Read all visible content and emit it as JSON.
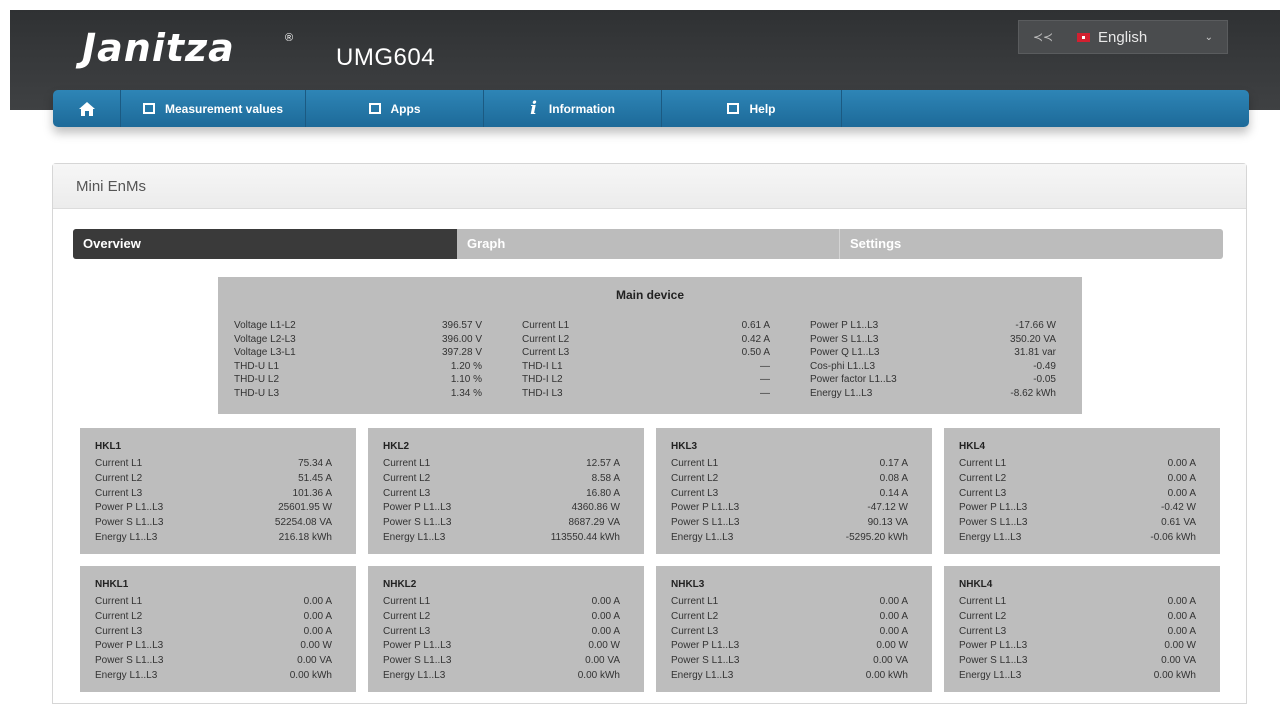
{
  "header": {
    "brand": "Janitza",
    "registered": "®",
    "model": "UMG604",
    "language": {
      "flag_icon": "flag-icon",
      "label": "English",
      "chevron": "⌄"
    }
  },
  "nav": {
    "home_icon": "home-icon",
    "items": [
      {
        "label": "Measurement values",
        "icon": "measurement-icon"
      },
      {
        "label": "Apps",
        "icon": "apps-icon"
      },
      {
        "label": "Information",
        "icon": "info-icon"
      },
      {
        "label": "Help",
        "icon": "help-icon"
      }
    ]
  },
  "panel": {
    "title": "Mini EnMs",
    "tabs": [
      "Overview",
      "Graph",
      "Settings"
    ]
  },
  "main_device": {
    "title": "Main device",
    "col1_labels": [
      "Voltage L1-L2",
      "Voltage L2-L3",
      "Voltage L3-L1",
      "THD-U L1",
      "THD-U L2",
      "THD-U L3"
    ],
    "col1_values": [
      "396.57 V",
      "396.00 V",
      "397.28 V",
      "1.20 %",
      "1.10 %",
      "1.34 %"
    ],
    "col2_labels": [
      "Current L1",
      "Current L2",
      "Current L3",
      "THD-I L1",
      "THD-I L2",
      "THD-I L3"
    ],
    "col2_values": [
      "0.61 A",
      "0.42 A",
      "0.50 A",
      "—",
      "—",
      "—"
    ],
    "col3_labels": [
      "Power P L1..L3",
      "Power S L1..L3",
      "Power Q L1..L3",
      "Cos-phi L1..L3",
      "Power factor L1..L3",
      "Energy L1..L3"
    ],
    "col3_values": [
      "-17.66 W",
      "350.20 VA",
      "31.81 var",
      "-0.49",
      "-0.05",
      "-8.62 kWh"
    ]
  },
  "boxes": [
    {
      "title": "HKL1",
      "labels": [
        "Current L1",
        "Current L2",
        "Current L3",
        "Power P L1..L3",
        "Power S L1..L3",
        "Energy L1..L3"
      ],
      "values": [
        "75.34 A",
        "51.45 A",
        "101.36 A",
        "25601.95 W",
        "52254.08 VA",
        "216.18 kWh"
      ]
    },
    {
      "title": "HKL2",
      "labels": [
        "Current L1",
        "Current L2",
        "Current L3",
        "Power P L1..L3",
        "Power S L1..L3",
        "Energy L1..L3"
      ],
      "values": [
        "12.57 A",
        "8.58 A",
        "16.80 A",
        "4360.86 W",
        "8687.29 VA",
        "113550.44 kWh"
      ]
    },
    {
      "title": "HKL3",
      "labels": [
        "Current L1",
        "Current L2",
        "Current L3",
        "Power P L1..L3",
        "Power S L1..L3",
        "Energy L1..L3"
      ],
      "values": [
        "0.17 A",
        "0.08 A",
        "0.14 A",
        "-47.12 W",
        "90.13 VA",
        "-5295.20 kWh"
      ]
    },
    {
      "title": "HKL4",
      "labels": [
        "Current L1",
        "Current L2",
        "Current L3",
        "Power P L1..L3",
        "Power S L1..L3",
        "Energy L1..L3"
      ],
      "values": [
        "0.00 A",
        "0.00 A",
        "0.00 A",
        "-0.42 W",
        "0.61 VA",
        "-0.06 kWh"
      ]
    },
    {
      "title": "NHKL1",
      "labels": [
        "Current L1",
        "Current L2",
        "Current L3",
        "Power P L1..L3",
        "Power S L1..L3",
        "Energy L1..L3"
      ],
      "values": [
        "0.00 A",
        "0.00 A",
        "0.00 A",
        "0.00 W",
        "0.00 VA",
        "0.00 kWh"
      ]
    },
    {
      "title": "NHKL2",
      "labels": [
        "Current L1",
        "Current L2",
        "Current L3",
        "Power P L1..L3",
        "Power S L1..L3",
        "Energy L1..L3"
      ],
      "values": [
        "0.00 A",
        "0.00 A",
        "0.00 A",
        "0.00 W",
        "0.00 VA",
        "0.00 kWh"
      ]
    },
    {
      "title": "NHKL3",
      "labels": [
        "Current L1",
        "Current L2",
        "Current L3",
        "Power P L1..L3",
        "Power S L1..L3",
        "Energy L1..L3"
      ],
      "values": [
        "0.00 A",
        "0.00 A",
        "0.00 A",
        "0.00 W",
        "0.00 VA",
        "0.00 kWh"
      ]
    },
    {
      "title": "NHKL4",
      "labels": [
        "Current L1",
        "Current L2",
        "Current L3",
        "Power P L1..L3",
        "Power S L1..L3",
        "Energy L1..L3"
      ],
      "values": [
        "0.00 A",
        "0.00 A",
        "0.00 A",
        "0.00 W",
        "0.00 VA",
        "0.00 kWh"
      ]
    }
  ],
  "colors": {
    "header_bg": "#37393b",
    "nav_bg": "#2479aa",
    "tab_active": "#3a3a3a",
    "tab_inactive": "#bcbcbc",
    "box_bg": "#bdbdbd"
  }
}
